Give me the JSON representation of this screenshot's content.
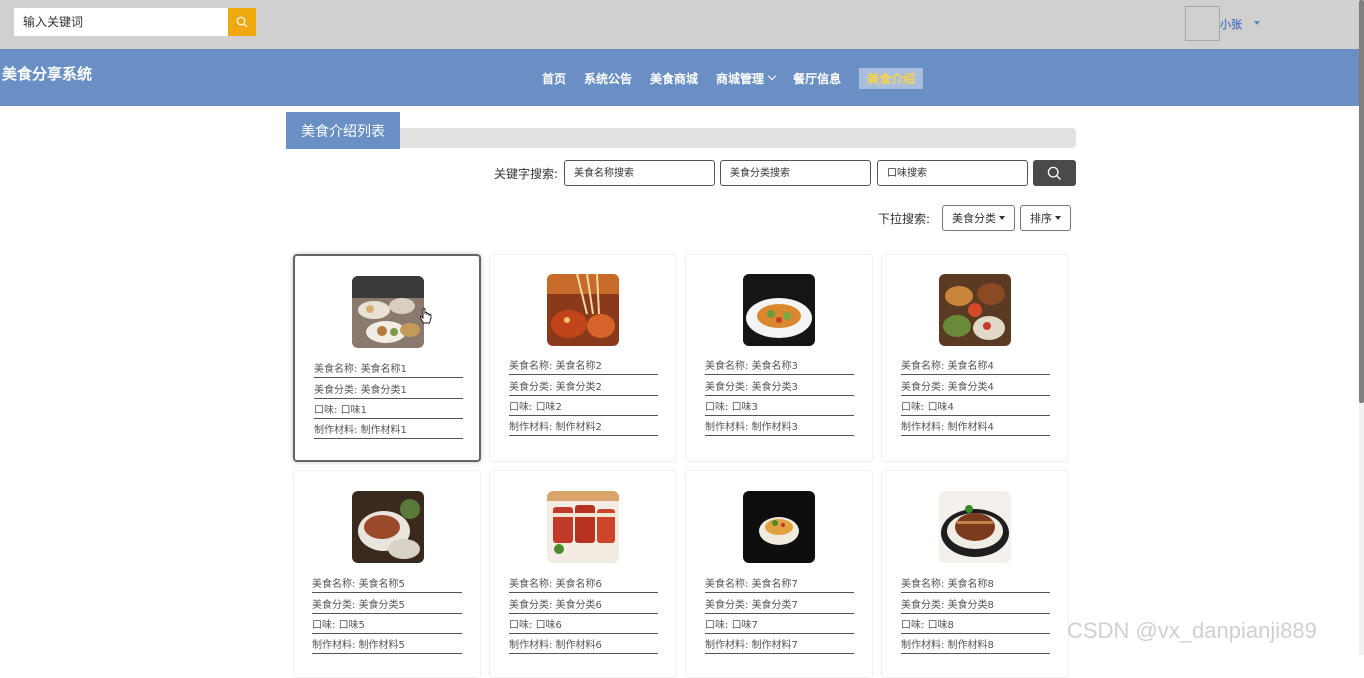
{
  "topbar": {
    "search_placeholder": "输入关键词",
    "username": "小张"
  },
  "navbar": {
    "brand": "美食分享系统",
    "items": [
      {
        "label": "首页"
      },
      {
        "label": "系统公告"
      },
      {
        "label": "美食商城"
      },
      {
        "label": "商城管理",
        "has_dropdown": true
      },
      {
        "label": "餐厅信息"
      },
      {
        "label": "美食介绍",
        "active": true
      }
    ],
    "active_color": "#f7d34a",
    "bar_color": "#6a8fc5"
  },
  "section": {
    "title": "美食介绍列表"
  },
  "search": {
    "keyword_label": "关键字搜索:",
    "name_placeholder": "美食名称搜索",
    "category_placeholder": "美食分类搜索",
    "taste_placeholder": "口味搜索"
  },
  "dropdowns": {
    "label": "下拉搜索:",
    "category": "美食分类",
    "sort": "排序"
  },
  "cards": [
    {
      "name_label": "美食名称:",
      "name": "美食名称1",
      "cat_label": "美食分类:",
      "category": "美食分类1",
      "taste_label": "口味:",
      "taste": "口味1",
      "mat_label": "制作材料:",
      "material": "制作材料1",
      "image": "food-photo-dim-sum"
    },
    {
      "name_label": "美食名称:",
      "name": "美食名称2",
      "cat_label": "美食分类:",
      "category": "美食分类2",
      "taste_label": "口味:",
      "taste": "口味2",
      "mat_label": "制作材料:",
      "material": "制作材料2",
      "image": "food-photo-skewers"
    },
    {
      "name_label": "美食名称:",
      "name": "美食名称3",
      "cat_label": "美食分类:",
      "category": "美食分类3",
      "taste_label": "口味:",
      "taste": "口味3",
      "mat_label": "制作材料:",
      "material": "制作材料3",
      "image": "food-photo-plated-dish"
    },
    {
      "name_label": "美食名称:",
      "name": "美食名称4",
      "cat_label": "美食分类:",
      "category": "美食分类4",
      "taste_label": "口味:",
      "taste": "口味4",
      "mat_label": "制作材料:",
      "material": "制作材料4",
      "image": "food-photo-feast"
    },
    {
      "name_label": "美食名称:",
      "name": "美食名称5",
      "cat_label": "美食分类:",
      "category": "美食分类5",
      "taste_label": "口味:",
      "taste": "口味5",
      "mat_label": "制作材料:",
      "material": "制作材料5",
      "image": "food-photo-roast-meat"
    },
    {
      "name_label": "美食名称:",
      "name": "美食名称6",
      "cat_label": "美食分类:",
      "category": "美食分类6",
      "taste_label": "口味:",
      "taste": "口味6",
      "mat_label": "制作材料:",
      "material": "制作材料6",
      "image": "food-photo-pork-belly"
    },
    {
      "name_label": "美食名称:",
      "name": "美食名称7",
      "cat_label": "美食分类:",
      "category": "美食分类7",
      "taste_label": "口味:",
      "taste": "口味7",
      "mat_label": "制作材料:",
      "material": "制作材料7",
      "image": "food-photo-noodle-bowl"
    },
    {
      "name_label": "美食名称:",
      "name": "美食名称8",
      "cat_label": "美食分类:",
      "category": "美食分类8",
      "taste_label": "口味:",
      "taste": "口味8",
      "mat_label": "制作材料:",
      "material": "制作材料8",
      "image": "food-photo-braised-pork"
    }
  ],
  "watermark": "CSDN @vx_danpianji889"
}
